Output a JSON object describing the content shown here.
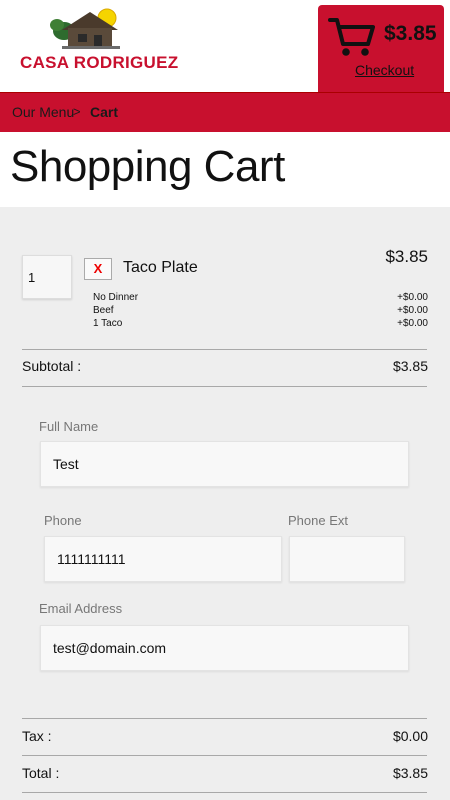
{
  "header": {
    "brand": "CASA RODRIGUEZ",
    "cart_total": "$3.85",
    "checkout_label": "Checkout"
  },
  "breadcrumb": {
    "items": [
      "Our Menu",
      "Cart"
    ],
    "separator": ">"
  },
  "page_title": "Shopping Cart",
  "cart": {
    "items": [
      {
        "quantity": "1",
        "remove_label": "X",
        "name": "Taco Plate",
        "price": "$3.85",
        "options": [
          {
            "label": "No Dinner",
            "price": "+$0.00"
          },
          {
            "label": "Beef",
            "price": "+$0.00"
          },
          {
            "label": "1 Taco",
            "price": "+$0.00"
          }
        ]
      }
    ],
    "subtotal_label": "Subtotal :",
    "subtotal": "$3.85",
    "tax_label": "Tax :",
    "tax": "$0.00",
    "total_label": "Total :",
    "total": "$3.85"
  },
  "form": {
    "full_name_label": "Full Name",
    "full_name": "Test",
    "phone_label": "Phone",
    "phone": "1111111111",
    "phone_ext_label": "Phone Ext",
    "phone_ext": "",
    "email_label": "Email Address",
    "email": "test@domain.com"
  },
  "colors": {
    "brand_red": "#c8102e",
    "panel_bg": "#eeeeee"
  }
}
